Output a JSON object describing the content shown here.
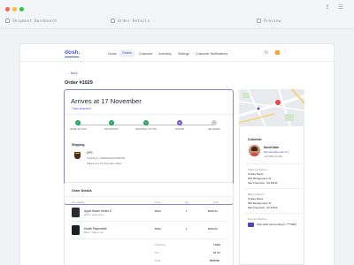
{
  "browser": {
    "tabs": [
      {
        "label": "Shipment Dashboard"
      },
      {
        "label": "Order Details"
      },
      {
        "label": "Preview"
      }
    ]
  },
  "nav": {
    "logo": "dosh.",
    "items": [
      "Home",
      "Orders",
      "Customer",
      "Inventory",
      "Settings",
      "Customer Notifications"
    ],
    "active": "Orders"
  },
  "back_label": "Back",
  "order_title": "Order #1029",
  "arrival": {
    "title": "Arrives at 17 November",
    "track_link": "Track shipment",
    "steps": [
      {
        "label": "ORDER PLACED",
        "status": "done"
      },
      {
        "label": "PROCESSING",
        "status": "done"
      },
      {
        "label": "PREPARING TO SHIP",
        "status": "done"
      },
      {
        "label": "SHIPPED",
        "status": "current"
      },
      {
        "label": "DELIVERED",
        "status": "pending"
      }
    ]
  },
  "shipping": {
    "label": "Shipping",
    "carrier": "UPS",
    "tracking": "Tracking #: 1Z999AA10123456784",
    "shipped_on": "Shipped on 15 November 2024"
  },
  "order_details": {
    "title": "Order Details",
    "columns": [
      "Item details",
      "Price",
      "Qty",
      "Total"
    ],
    "items": [
      {
        "name": "Apple Watch Series 5",
        "meta": "White  •  Space Grey",
        "price": "$599",
        "qty": "1",
        "total": "$599.00"
      },
      {
        "name": "Kindle Paperwhite",
        "meta": "Black  •  Waterproof",
        "price": "$599",
        "qty": "1",
        "total": "$599.00"
      }
    ],
    "summary": [
      {
        "label": "Shipping",
        "value": "FREE"
      },
      {
        "label": "Tax",
        "value": "$3.99"
      },
      {
        "label": "Total",
        "value": "$725.00"
      }
    ]
  },
  "customer": {
    "heading": "Customer",
    "name": "David Allen",
    "email": "allendavid@email.com",
    "phone": "+34 599 112 445"
  },
  "shipping_address": {
    "heading": "Shipping Address",
    "lines": [
      "Smiles Davis",
      "600 Montgomery St",
      "San Francisco, CA 94111"
    ]
  },
  "billing_address": {
    "heading": "Billing Address",
    "lines": [
      "Smiles Davis",
      "600 Montgomery St",
      "San Francisco, CA 94111"
    ]
  },
  "payment": {
    "heading": "Payment Method",
    "text": "Visa debit card ending in ****2824"
  },
  "colors": {
    "accent": "#4c57d9",
    "done": "#22a45d",
    "current": "#7b4fe0",
    "pending": "#c7ccd6"
  }
}
